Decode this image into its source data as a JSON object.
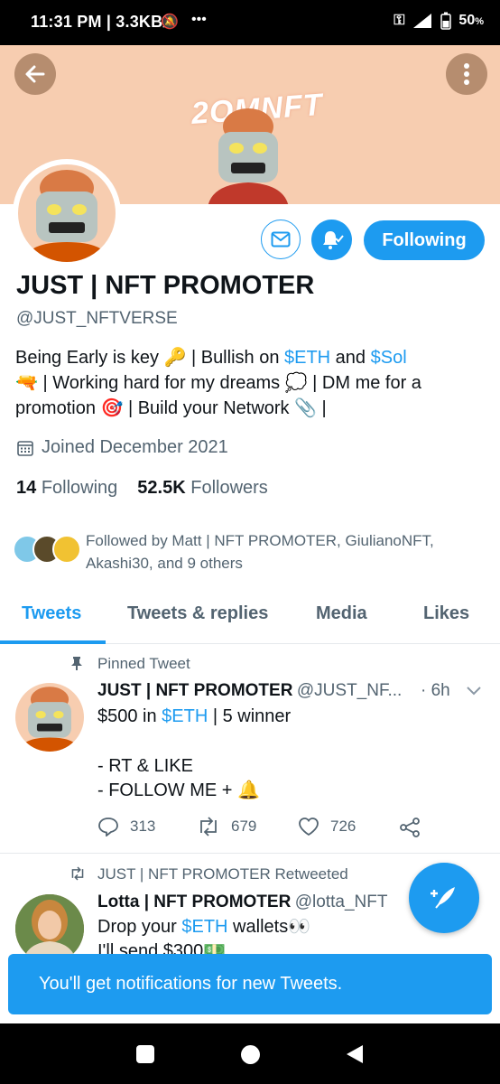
{
  "status_bar": {
    "time": "11:31 PM | 3.3KB/s",
    "dots": "•••",
    "battery": "50"
  },
  "banner": {
    "text": "2OMNFT"
  },
  "profile": {
    "name": "JUST | NFT PROMOTER",
    "handle": "@JUST_NFTVERSE",
    "bio_1": "Being Early is key 🔑 | Bullish on ",
    "bio_eth": "$ETH",
    "bio_and": " and ",
    "bio_sol": "$Sol",
    "bio_2": "🔫 | Working hard for my dreams 💭 | DM me for a promotion 🎯 | Build your Network 📎 |",
    "joined": "Joined December 2021",
    "following_count": "14",
    "following_label": "Following",
    "followers_count": "52.5K",
    "followers_label": "Followers",
    "followed_by": "Followed by Matt | NFT PROMOTER, GiulianoNFT, Akashi30, and 9 others",
    "following_button": "Following"
  },
  "tabs": [
    "Tweets",
    "Tweets & replies",
    "Media",
    "Likes"
  ],
  "pinned_tweet": {
    "pinned_label": "Pinned Tweet",
    "name": "JUST | NFT PROMOTER",
    "handle": "@JUST_NF...",
    "time": "· 6h",
    "line1_a": "$500 in ",
    "line1_eth": "$ETH",
    "line1_b": " | 5 winner",
    "line2": "- RT & LIKE",
    "line3": "- FOLLOW ME + 🔔",
    "replies": "313",
    "retweets": "679",
    "likes": "726"
  },
  "retweet": {
    "retweeted_label": "JUST | NFT PROMOTER Retweeted",
    "name": "Lotta | NFT PROMOTER",
    "handle": "@lotta_NFT",
    "line1_a": "Drop your ",
    "line1_eth": "$ETH",
    "line1_b": " wallets👀",
    "line2": "I'll send $300💵"
  },
  "toast": "You'll get notifications for new Tweets.",
  "colors": {
    "accent": "#1d9bf0",
    "banner": "#f7cdb0",
    "text": "#0f1419",
    "muted": "#536471"
  }
}
